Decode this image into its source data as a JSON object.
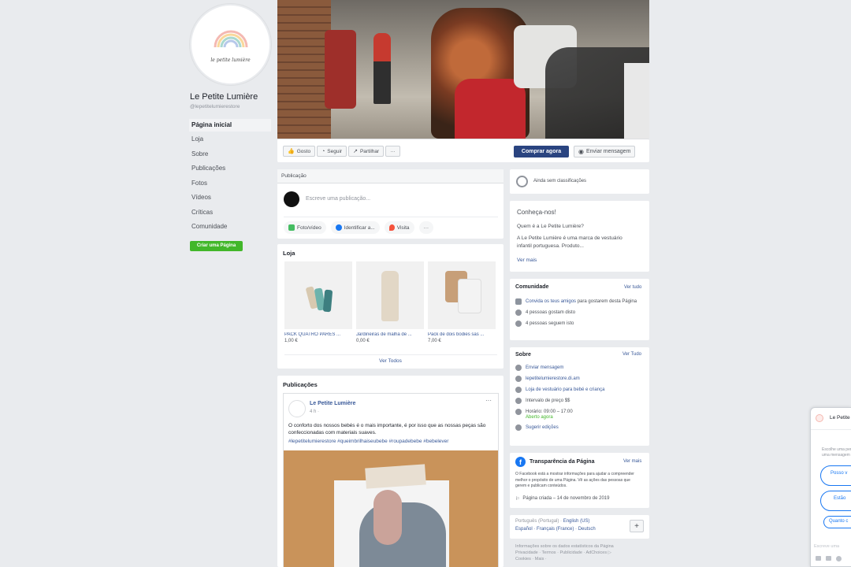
{
  "page": {
    "name": "Le Petite Lumière",
    "handle": "@lepetitelumierestore",
    "logo_text": "le petite lumière"
  },
  "sidebar": {
    "items": [
      {
        "label": "Página inicial",
        "active": true
      },
      {
        "label": "Loja"
      },
      {
        "label": "Sobre"
      },
      {
        "label": "Publicações"
      },
      {
        "label": "Fotos"
      },
      {
        "label": "Vídeos"
      },
      {
        "label": "Críticas"
      },
      {
        "label": "Comunidade"
      }
    ],
    "create_page": "Criar uma Página"
  },
  "actions": {
    "like": "Gosto",
    "follow": "Seguir",
    "share": "Partilhar",
    "more": "···",
    "shop_now": "Comprar agora",
    "send_message": "Enviar mensagem"
  },
  "composer": {
    "title": "Publicação",
    "placeholder": "Escreve uma publicação...",
    "photo_video": "Foto/vídeo",
    "tag": "Identificar a...",
    "checkin": "Visita",
    "more": "···"
  },
  "shop": {
    "title": "Loja",
    "products": [
      {
        "name": "PACK QUATRO PARES ...",
        "price": "1,00 €"
      },
      {
        "name": "Jardineiras de malha de ...",
        "price": "0,00 €"
      },
      {
        "name": "Pack de dois bodies sas ...",
        "price": "7,00 €"
      }
    ],
    "see_all": "Ver Todos"
  },
  "posts": {
    "title": "Publicações",
    "author": "Le Petite Lumière",
    "time": "4 h ·",
    "text": "O conforto dos nossos bebés é o mais importante, é por isso que as nossas peças são confeccionadas com materiais suaves.",
    "hashtags": "#lepetitelumierestore #queimbrilhaiseubebe #roupadebebe #bebelever"
  },
  "rating": {
    "text": "Ainda sem classificações"
  },
  "about_short": {
    "title": "Conheça-nos!",
    "question": "Quem é a Le Petite Lumière?",
    "desc": "A Le Petite Lumière é uma marca de vestuário infantil portuguesa. Produto...",
    "see_more": "Ver mais"
  },
  "community": {
    "title": "Comunidade",
    "see_all": "Ver tudo",
    "invite_link": "Convida os teus amigos",
    "invite_rest": " para gostarem desta Página",
    "likes": "4 pessoas gostam disto",
    "follows": "4 pessoas seguem isto"
  },
  "about": {
    "title": "Sobre",
    "see_all": "Ver Tudo",
    "send_message": "Enviar mensagem",
    "website": "lepetitelumierestore.di.am",
    "category": "Loja de vestuário para bebé e criança",
    "price": "Intervalo de preço $$",
    "hours": "Horário: 09:00 – 17:00",
    "open_now": "Aberto agora",
    "suggest": "Sugerir edições"
  },
  "transparency": {
    "title": "Transparência da Página",
    "see_more": "Ver mais",
    "desc": "O Facebook está a mostrar informações para ajudar a compreender melhor o propósito de uma Página. Vê as ações das pessoas que gerem e publicam conteúdos.",
    "created": "Página criada – 14 de novembro de 2019"
  },
  "languages": {
    "line1a": "Português (Portugal)",
    "line1b": "English (US)",
    "line2a": "Español",
    "line2b": "Français (France)",
    "line2c": "Deutsch",
    "add": "+"
  },
  "footer": {
    "line1": "Informações sobre os dados estatísticos da Página",
    "line2": "Privacidade · Termos · Publicidade · AdChoices ▷",
    "line3": "Cookies · Mais ·"
  },
  "chat": {
    "intro": "Escolhe uma pergunta ou envia uma mensagem à página",
    "q1": "Posso v",
    "q2": "Estão",
    "q3": "Quanto c",
    "input_placeholder": "Escreve uma"
  },
  "colors": {
    "brand": "#385898",
    "shop_button": "#2a4480",
    "create_page": "#42b72a",
    "background": "#e9ebee"
  }
}
